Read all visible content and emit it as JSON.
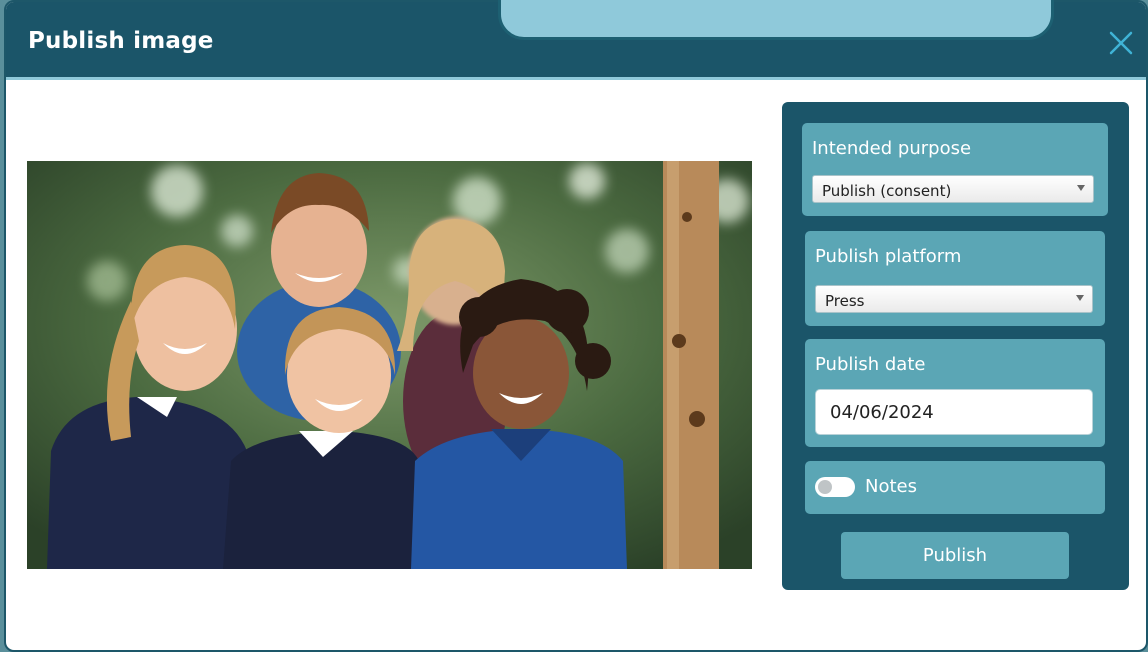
{
  "dialog": {
    "title": "Publish image",
    "close_icon": "close-icon"
  },
  "photo": {
    "alt": "Group photo of smiling school children in navy and blue uniforms outdoors"
  },
  "form": {
    "purpose": {
      "label": "Intended purpose",
      "value": "Publish (consent)"
    },
    "platform": {
      "label": "Publish platform",
      "value": "Press"
    },
    "date": {
      "label": "Publish date",
      "value": "04/06/2024"
    },
    "notes": {
      "label": "Notes",
      "enabled": false
    },
    "publish_label": "Publish"
  },
  "colors": {
    "header": "#1b5569",
    "panel": "#1b5569",
    "card": "#5ba6b5",
    "accent": "#8fc9da"
  }
}
